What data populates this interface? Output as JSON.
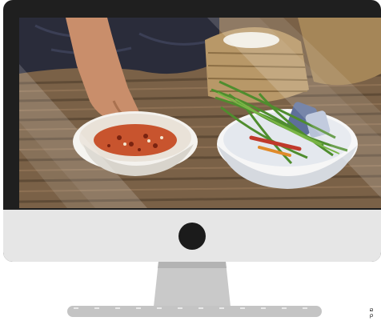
{
  "device": {
    "type": "desktop monitor",
    "frame_color": "#1f1f1f",
    "chin_color": "#e6e6e6",
    "stand_color": "#c4c4c4"
  },
  "screen_image": {
    "icon": "food-photo-image"
  },
  "corner_mark": {
    "line1": "ລ",
    "line2": "ρ"
  }
}
